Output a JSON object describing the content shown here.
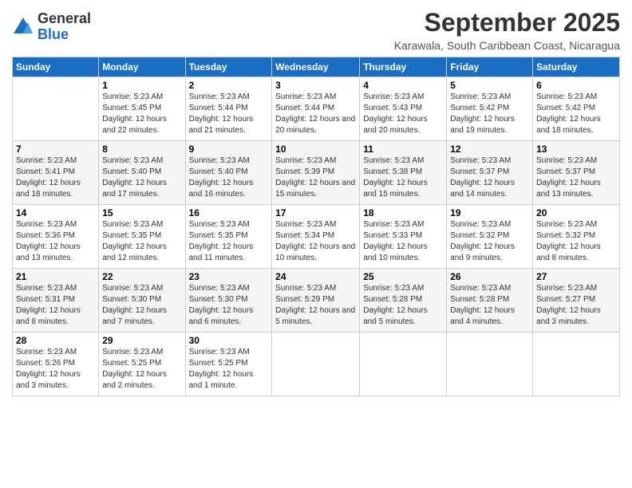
{
  "logo": {
    "general": "General",
    "blue": "Blue"
  },
  "title": "September 2025",
  "location": "Karawala, South Caribbean Coast, Nicaragua",
  "days_of_week": [
    "Sunday",
    "Monday",
    "Tuesday",
    "Wednesday",
    "Thursday",
    "Friday",
    "Saturday"
  ],
  "weeks": [
    [
      {
        "day": "",
        "info": ""
      },
      {
        "day": "1",
        "info": "Sunrise: 5:23 AM\nSunset: 5:45 PM\nDaylight: 12 hours\nand 22 minutes."
      },
      {
        "day": "2",
        "info": "Sunrise: 5:23 AM\nSunset: 5:44 PM\nDaylight: 12 hours\nand 21 minutes."
      },
      {
        "day": "3",
        "info": "Sunrise: 5:23 AM\nSunset: 5:44 PM\nDaylight: 12 hours\nand 20 minutes."
      },
      {
        "day": "4",
        "info": "Sunrise: 5:23 AM\nSunset: 5:43 PM\nDaylight: 12 hours\nand 20 minutes."
      },
      {
        "day": "5",
        "info": "Sunrise: 5:23 AM\nSunset: 5:42 PM\nDaylight: 12 hours\nand 19 minutes."
      },
      {
        "day": "6",
        "info": "Sunrise: 5:23 AM\nSunset: 5:42 PM\nDaylight: 12 hours\nand 18 minutes."
      }
    ],
    [
      {
        "day": "7",
        "info": "Sunrise: 5:23 AM\nSunset: 5:41 PM\nDaylight: 12 hours\nand 18 minutes."
      },
      {
        "day": "8",
        "info": "Sunrise: 5:23 AM\nSunset: 5:40 PM\nDaylight: 12 hours\nand 17 minutes."
      },
      {
        "day": "9",
        "info": "Sunrise: 5:23 AM\nSunset: 5:40 PM\nDaylight: 12 hours\nand 16 minutes."
      },
      {
        "day": "10",
        "info": "Sunrise: 5:23 AM\nSunset: 5:39 PM\nDaylight: 12 hours\nand 15 minutes."
      },
      {
        "day": "11",
        "info": "Sunrise: 5:23 AM\nSunset: 5:38 PM\nDaylight: 12 hours\nand 15 minutes."
      },
      {
        "day": "12",
        "info": "Sunrise: 5:23 AM\nSunset: 5:37 PM\nDaylight: 12 hours\nand 14 minutes."
      },
      {
        "day": "13",
        "info": "Sunrise: 5:23 AM\nSunset: 5:37 PM\nDaylight: 12 hours\nand 13 minutes."
      }
    ],
    [
      {
        "day": "14",
        "info": "Sunrise: 5:23 AM\nSunset: 5:36 PM\nDaylight: 12 hours\nand 13 minutes."
      },
      {
        "day": "15",
        "info": "Sunrise: 5:23 AM\nSunset: 5:35 PM\nDaylight: 12 hours\nand 12 minutes."
      },
      {
        "day": "16",
        "info": "Sunrise: 5:23 AM\nSunset: 5:35 PM\nDaylight: 12 hours\nand 11 minutes."
      },
      {
        "day": "17",
        "info": "Sunrise: 5:23 AM\nSunset: 5:34 PM\nDaylight: 12 hours\nand 10 minutes."
      },
      {
        "day": "18",
        "info": "Sunrise: 5:23 AM\nSunset: 5:33 PM\nDaylight: 12 hours\nand 10 minutes."
      },
      {
        "day": "19",
        "info": "Sunrise: 5:23 AM\nSunset: 5:32 PM\nDaylight: 12 hours\nand 9 minutes."
      },
      {
        "day": "20",
        "info": "Sunrise: 5:23 AM\nSunset: 5:32 PM\nDaylight: 12 hours\nand 8 minutes."
      }
    ],
    [
      {
        "day": "21",
        "info": "Sunrise: 5:23 AM\nSunset: 5:31 PM\nDaylight: 12 hours\nand 8 minutes."
      },
      {
        "day": "22",
        "info": "Sunrise: 5:23 AM\nSunset: 5:30 PM\nDaylight: 12 hours\nand 7 minutes."
      },
      {
        "day": "23",
        "info": "Sunrise: 5:23 AM\nSunset: 5:30 PM\nDaylight: 12 hours\nand 6 minutes."
      },
      {
        "day": "24",
        "info": "Sunrise: 5:23 AM\nSunset: 5:29 PM\nDaylight: 12 hours\nand 5 minutes."
      },
      {
        "day": "25",
        "info": "Sunrise: 5:23 AM\nSunset: 5:28 PM\nDaylight: 12 hours\nand 5 minutes."
      },
      {
        "day": "26",
        "info": "Sunrise: 5:23 AM\nSunset: 5:28 PM\nDaylight: 12 hours\nand 4 minutes."
      },
      {
        "day": "27",
        "info": "Sunrise: 5:23 AM\nSunset: 5:27 PM\nDaylight: 12 hours\nand 3 minutes."
      }
    ],
    [
      {
        "day": "28",
        "info": "Sunrise: 5:23 AM\nSunset: 5:26 PM\nDaylight: 12 hours\nand 3 minutes."
      },
      {
        "day": "29",
        "info": "Sunrise: 5:23 AM\nSunset: 5:25 PM\nDaylight: 12 hours\nand 2 minutes."
      },
      {
        "day": "30",
        "info": "Sunrise: 5:23 AM\nSunset: 5:25 PM\nDaylight: 12 hours\nand 1 minute."
      },
      {
        "day": "",
        "info": ""
      },
      {
        "day": "",
        "info": ""
      },
      {
        "day": "",
        "info": ""
      },
      {
        "day": "",
        "info": ""
      }
    ]
  ]
}
